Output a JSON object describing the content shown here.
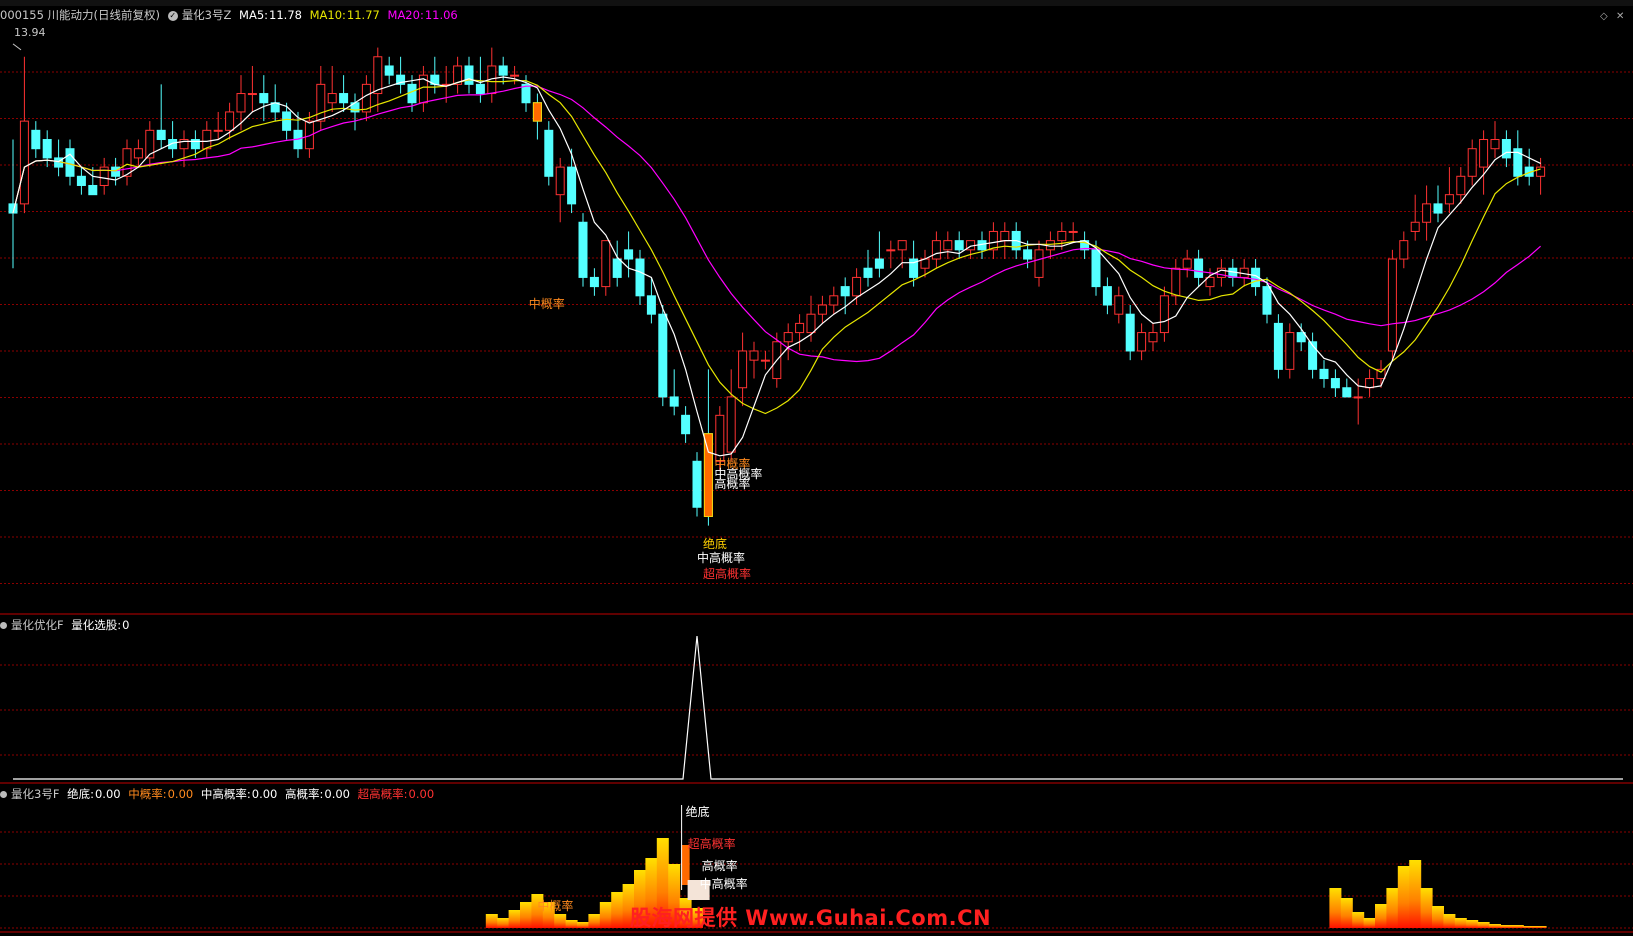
{
  "header": {
    "symbol": "000155 川能动力(日线前复权)",
    "indicator": "量化3号Z",
    "ma5_label": "MA5:",
    "ma5_value": "11.78",
    "ma10_label": "MA10:",
    "ma10_value": "11.77",
    "ma20_label": "MA20:",
    "ma20_value": "11.06",
    "high_marker": "13.94"
  },
  "panel2": {
    "name": "量化优化F",
    "label": "量化选股:",
    "value": "0"
  },
  "panel3": {
    "name": "量化3号F",
    "items": [
      {
        "label": "绝底:",
        "value": "0.00"
      },
      {
        "label": "中概率:",
        "value": "0.00"
      },
      {
        "label": "中高概率:",
        "value": "0.00"
      },
      {
        "label": "高概率:",
        "value": "0.00"
      },
      {
        "label": "超高概率:",
        "value": "0.00"
      }
    ]
  },
  "watermark": "股海网提供 Www.Guhai.Com.CN",
  "colors": {
    "up": "#ff3232",
    "down": "#54ffff",
    "ma5": "#ffffff",
    "ma10": "#e6e600",
    "ma20": "#ff00ff",
    "grid": "#8b0000",
    "orange": "#ff8a1e",
    "signal_orange": "#ff6a00"
  },
  "chart_data": [
    {
      "type": "candlestick",
      "title": "000155 川能动力(日线前复权)",
      "ylim": [
        8.0,
        14.2
      ],
      "series": [
        {
          "name": "K",
          "ohlc": [
            [
              12.2,
              12.9,
              11.5,
              12.1
            ],
            [
              12.2,
              13.8,
              12.1,
              13.1
            ],
            [
              13.0,
              13.1,
              12.7,
              12.8
            ],
            [
              12.9,
              13.0,
              12.6,
              12.7
            ],
            [
              12.7,
              12.9,
              12.5,
              12.6
            ],
            [
              12.8,
              12.9,
              12.4,
              12.5
            ],
            [
              12.5,
              12.6,
              12.3,
              12.4
            ],
            [
              12.4,
              12.6,
              12.3,
              12.3
            ],
            [
              12.4,
              12.7,
              12.3,
              12.6
            ],
            [
              12.6,
              12.7,
              12.4,
              12.5
            ],
            [
              12.5,
              12.9,
              12.4,
              12.8
            ],
            [
              12.7,
              12.9,
              12.6,
              12.8
            ],
            [
              12.7,
              13.1,
              12.6,
              13.0
            ],
            [
              13.0,
              13.5,
              12.8,
              12.9
            ],
            [
              12.9,
              13.1,
              12.7,
              12.8
            ],
            [
              12.8,
              13.0,
              12.6,
              12.9
            ],
            [
              12.9,
              13.0,
              12.7,
              12.8
            ],
            [
              12.8,
              13.1,
              12.7,
              13.0
            ],
            [
              13.0,
              13.2,
              12.9,
              13.0
            ],
            [
              13.0,
              13.3,
              12.9,
              13.2
            ],
            [
              13.2,
              13.6,
              13.0,
              13.4
            ],
            [
              13.4,
              13.7,
              13.2,
              13.4
            ],
            [
              13.4,
              13.6,
              13.1,
              13.3
            ],
            [
              13.3,
              13.5,
              13.1,
              13.2
            ],
            [
              13.2,
              13.3,
              12.9,
              13.0
            ],
            [
              13.0,
              13.2,
              12.7,
              12.8
            ],
            [
              12.8,
              13.2,
              12.7,
              13.1
            ],
            [
              13.1,
              13.7,
              13.0,
              13.5
            ],
            [
              13.3,
              13.7,
              13.2,
              13.4
            ],
            [
              13.4,
              13.6,
              13.2,
              13.3
            ],
            [
              13.3,
              13.4,
              13.0,
              13.2
            ],
            [
              13.2,
              13.6,
              13.1,
              13.5
            ],
            [
              13.4,
              13.9,
              13.2,
              13.8
            ],
            [
              13.7,
              13.8,
              13.5,
              13.6
            ],
            [
              13.6,
              13.8,
              13.4,
              13.5
            ],
            [
              13.5,
              13.6,
              13.2,
              13.3
            ],
            [
              13.3,
              13.7,
              13.2,
              13.6
            ],
            [
              13.6,
              13.8,
              13.4,
              13.5
            ],
            [
              13.5,
              13.7,
              13.3,
              13.5
            ],
            [
              13.5,
              13.8,
              13.4,
              13.7
            ],
            [
              13.7,
              13.8,
              13.4,
              13.5
            ],
            [
              13.5,
              13.8,
              13.3,
              13.4
            ],
            [
              13.4,
              13.9,
              13.3,
              13.7
            ],
            [
              13.7,
              13.8,
              13.5,
              13.6
            ],
            [
              13.6,
              13.7,
              13.5,
              13.6
            ],
            [
              13.5,
              13.6,
              13.2,
              13.3
            ],
            [
              13.3,
              13.4,
              12.9,
              13.1
            ],
            [
              13.0,
              13.1,
              12.4,
              12.5
            ],
            [
              12.3,
              12.7,
              12.0,
              12.6
            ],
            [
              12.6,
              12.8,
              12.1,
              12.2
            ],
            [
              12.0,
              12.1,
              11.3,
              11.4
            ],
            [
              11.4,
              11.5,
              11.2,
              11.3
            ],
            [
              11.3,
              11.8,
              11.2,
              11.8
            ],
            [
              11.6,
              11.8,
              11.3,
              11.4
            ],
            [
              11.7,
              11.9,
              11.4,
              11.6
            ],
            [
              11.6,
              11.7,
              11.1,
              11.2
            ],
            [
              11.2,
              11.4,
              10.9,
              11.0
            ],
            [
              11.0,
              11.1,
              10.0,
              10.1
            ],
            [
              10.1,
              10.4,
              9.9,
              10.0
            ],
            [
              9.9,
              10.0,
              9.6,
              9.7
            ],
            [
              9.4,
              9.5,
              8.8,
              8.9
            ],
            [
              9.7,
              10.4,
              8.7,
              8.8
            ],
            [
              9.4,
              10.0,
              9.3,
              9.9
            ],
            [
              9.5,
              10.4,
              9.4,
              10.1
            ],
            [
              10.2,
              10.8,
              10.0,
              10.6
            ],
            [
              10.5,
              10.7,
              10.3,
              10.6
            ],
            [
              10.5,
              10.6,
              10.4,
              10.5
            ],
            [
              10.3,
              10.8,
              10.2,
              10.7
            ],
            [
              10.7,
              10.9,
              10.5,
              10.8
            ],
            [
              10.8,
              11.0,
              10.6,
              10.9
            ],
            [
              10.8,
              11.2,
              10.7,
              11.0
            ],
            [
              11.0,
              11.2,
              10.9,
              11.1
            ],
            [
              11.1,
              11.3,
              11.0,
              11.2
            ],
            [
              11.3,
              11.4,
              11.0,
              11.2
            ],
            [
              11.2,
              11.5,
              11.1,
              11.4
            ],
            [
              11.5,
              11.7,
              11.3,
              11.4
            ],
            [
              11.6,
              11.9,
              11.4,
              11.5
            ],
            [
              11.7,
              11.8,
              11.5,
              11.7
            ],
            [
              11.7,
              11.8,
              11.5,
              11.8
            ],
            [
              11.6,
              11.8,
              11.3,
              11.4
            ],
            [
              11.5,
              11.7,
              11.4,
              11.6
            ],
            [
              11.6,
              11.9,
              11.5,
              11.8
            ],
            [
              11.7,
              11.9,
              11.6,
              11.8
            ],
            [
              11.8,
              11.9,
              11.6,
              11.7
            ],
            [
              11.7,
              11.8,
              11.6,
              11.8
            ],
            [
              11.8,
              11.9,
              11.6,
              11.7
            ],
            [
              11.7,
              12.0,
              11.6,
              11.9
            ],
            [
              11.8,
              12.0,
              11.6,
              11.9
            ],
            [
              11.9,
              12.0,
              11.6,
              11.7
            ],
            [
              11.7,
              11.8,
              11.5,
              11.6
            ],
            [
              11.4,
              11.8,
              11.3,
              11.7
            ],
            [
              11.7,
              11.9,
              11.6,
              11.8
            ],
            [
              11.8,
              12.0,
              11.7,
              11.9
            ],
            [
              11.9,
              12.0,
              11.8,
              11.9
            ],
            [
              11.8,
              11.9,
              11.6,
              11.7
            ],
            [
              11.7,
              11.8,
              11.2,
              11.3
            ],
            [
              11.3,
              11.4,
              11.0,
              11.1
            ],
            [
              11.0,
              11.3,
              10.9,
              11.2
            ],
            [
              11.0,
              11.1,
              10.5,
              10.6
            ],
            [
              10.6,
              10.9,
              10.5,
              10.8
            ],
            [
              10.7,
              10.9,
              10.6,
              10.8
            ],
            [
              10.8,
              11.3,
              10.7,
              11.2
            ],
            [
              11.2,
              11.6,
              11.1,
              11.5
            ],
            [
              11.5,
              11.7,
              11.4,
              11.6
            ],
            [
              11.6,
              11.7,
              11.3,
              11.4
            ],
            [
              11.3,
              11.5,
              11.2,
              11.4
            ],
            [
              11.4,
              11.6,
              11.3,
              11.5
            ],
            [
              11.5,
              11.6,
              11.3,
              11.4
            ],
            [
              11.4,
              11.6,
              11.3,
              11.5
            ],
            [
              11.5,
              11.6,
              11.2,
              11.3
            ],
            [
              11.3,
              11.4,
              10.9,
              11.0
            ],
            [
              10.9,
              11.0,
              10.3,
              10.4
            ],
            [
              10.4,
              10.9,
              10.3,
              10.8
            ],
            [
              10.8,
              10.9,
              10.6,
              10.7
            ],
            [
              10.7,
              10.8,
              10.3,
              10.4
            ],
            [
              10.4,
              10.5,
              10.2,
              10.3
            ],
            [
              10.3,
              10.4,
              10.1,
              10.2
            ],
            [
              10.2,
              10.3,
              10.1,
              10.1
            ],
            [
              10.1,
              10.3,
              9.8,
              10.1
            ],
            [
              10.2,
              10.4,
              10.1,
              10.3
            ],
            [
              10.3,
              10.5,
              10.2,
              10.4
            ],
            [
              10.6,
              11.7,
              10.5,
              11.6
            ],
            [
              11.6,
              11.9,
              11.5,
              11.8
            ],
            [
              11.9,
              12.3,
              11.8,
              12.0
            ],
            [
              12.0,
              12.4,
              11.8,
              12.2
            ],
            [
              12.2,
              12.4,
              12.0,
              12.1
            ],
            [
              12.2,
              12.6,
              12.1,
              12.3
            ],
            [
              12.3,
              12.6,
              12.2,
              12.5
            ],
            [
              12.5,
              12.9,
              12.4,
              12.8
            ],
            [
              12.6,
              13.0,
              12.3,
              12.9
            ],
            [
              12.8,
              13.1,
              12.7,
              12.9
            ],
            [
              12.9,
              13.0,
              12.6,
              12.7
            ],
            [
              12.8,
              13.0,
              12.4,
              12.5
            ],
            [
              12.6,
              12.8,
              12.4,
              12.5
            ],
            [
              12.5,
              12.7,
              12.3,
              12.6
            ]
          ]
        }
      ]
    },
    {
      "type": "line",
      "title": "量化优化F",
      "series": [
        {
          "name": "量化选股",
          "spike_index": 60,
          "spike_value": 1
        }
      ]
    },
    {
      "type": "bar",
      "title": "量化3号F",
      "signals": [
        "绝底",
        "中概率",
        "中高概率",
        "高概率",
        "超高概率"
      ]
    }
  ]
}
